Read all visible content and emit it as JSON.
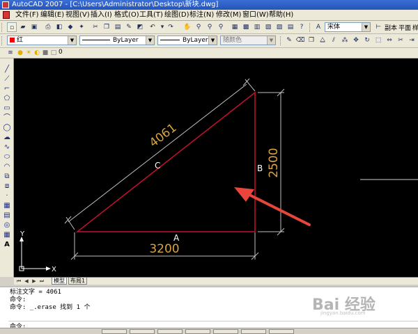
{
  "window": {
    "title": "AutoCAD 2007 - [C:\\Users\\Administrator\\Desktop\\新块.dwg]"
  },
  "menu": [
    "文件(F)",
    "编辑(E)",
    "视图(V)",
    "插入(I)",
    "格式(O)",
    "工具(T)",
    "绘图(D)",
    "标注(N)",
    "修改(M)",
    "窗口(W)",
    "帮助(H)"
  ],
  "toolbar": {
    "font_value": "宋体",
    "sub_labels": [
      "副本",
      "平面",
      "样"
    ],
    "color_value": "红",
    "linetype_value": "ByLayer",
    "lineweight_value": "ByLayer",
    "plotstyle_value": "随颜色",
    "layer_value": "0"
  },
  "drawing": {
    "hyp_dim": "4061",
    "vert_dim": "2500",
    "horiz_dim": "3200",
    "label_a": "A",
    "label_b": "B",
    "label_c": "C",
    "ucs_x": "X",
    "ucs_y": "Y"
  },
  "tabs": [
    "模型",
    "布局1"
  ],
  "command": {
    "lines": [
      "标注文字 = 4061",
      "命令:",
      "命令: _.erase 找到 1 个"
    ],
    "prompt": "命令:"
  },
  "watermark": {
    "text": "Bai 经验",
    "sub": "jingyan.baidu.com"
  },
  "colors": {
    "triangle": "#c8102e",
    "dimension_text": "#d9a441",
    "dimension_lines": "#bfbfbf",
    "arrow": "#e8453c"
  }
}
